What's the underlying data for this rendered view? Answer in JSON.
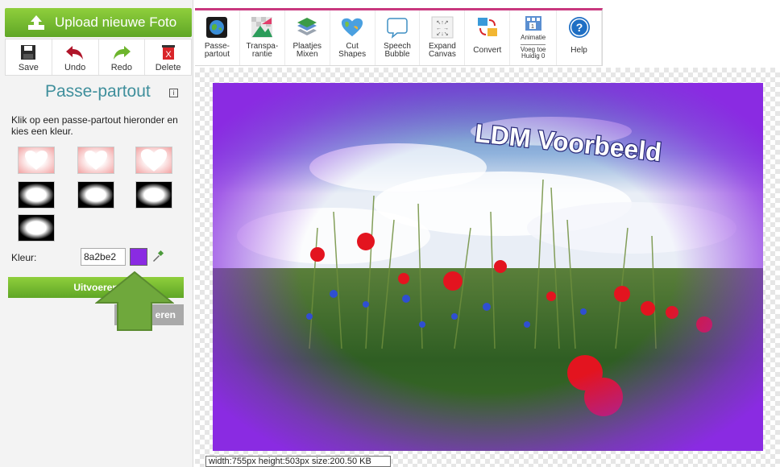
{
  "upload": {
    "label": "Upload nieuwe Foto"
  },
  "left_toolbar": [
    {
      "label": "Save",
      "icon": "save-icon"
    },
    {
      "label": "Undo",
      "icon": "undo-icon"
    },
    {
      "label": "Redo",
      "icon": "redo-icon"
    },
    {
      "label": "Delete",
      "icon": "delete-icon"
    }
  ],
  "panel": {
    "title": "Passe-partout",
    "info_icon": "i",
    "instructions": "Klik op een passe-partout hieronder en kies een kleur.",
    "kleur_label": "Kleur:",
    "kleur_value": "8a2be2",
    "swatch_color": "#8a2be2",
    "apply_label": "Uitvoeren",
    "reset_label": "eren"
  },
  "top_toolbar": {
    "tools": [
      {
        "line1": "Passe-",
        "line2": "partout",
        "icon": "passe-partout-icon"
      },
      {
        "line1": "Transpa-",
        "line2": "rantie",
        "icon": "transparency-icon"
      },
      {
        "line1": "Plaatjes",
        "line2": "Mixen",
        "icon": "layers-icon"
      },
      {
        "line1": "Cut",
        "line2": "Shapes",
        "icon": "heart-shape-icon"
      },
      {
        "line1": "Speech",
        "line2": "Bubble",
        "icon": "speech-bubble-icon"
      },
      {
        "line1": "Expand",
        "line2": "Canvas",
        "icon": "expand-canvas-icon"
      },
      {
        "line1": "Convert",
        "line2": "",
        "icon": "convert-icon"
      }
    ],
    "animation": {
      "label": "Animatie",
      "sub1": "Voeg toe",
      "sub2": "Huidig 0",
      "icon": "animation-icon"
    },
    "help": {
      "label": "Help",
      "icon": "help-icon"
    }
  },
  "image": {
    "watermark": "LDM Voorbeeld"
  },
  "status": {
    "text": "width:755px  height:503px  size:200.50 KB"
  },
  "colors": {
    "brand_green": "#6db52d",
    "accent_pink": "#c9387f",
    "title_teal": "#3f8f9c",
    "frame_purple": "#8a2be2"
  }
}
